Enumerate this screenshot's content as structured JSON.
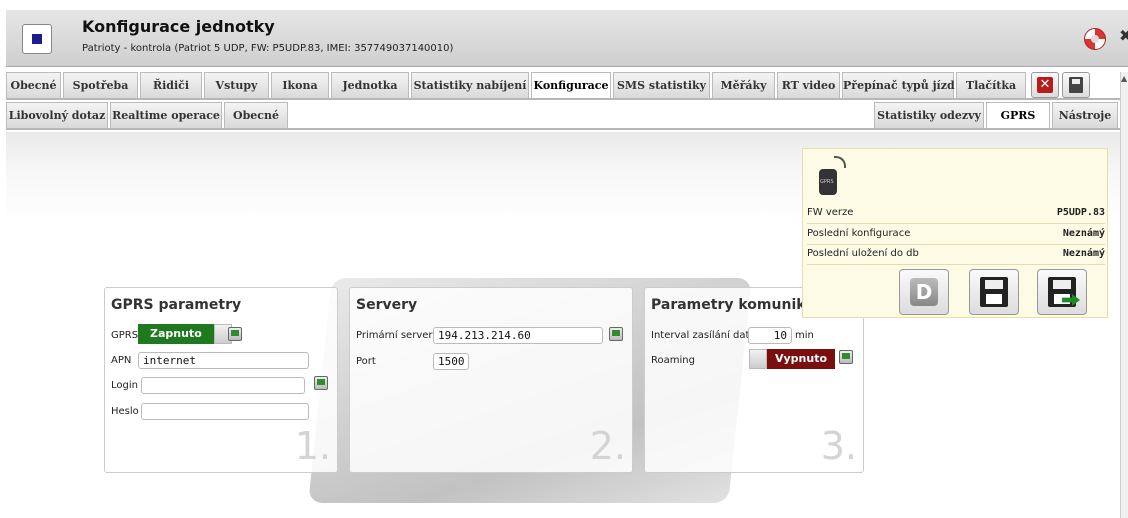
{
  "header": {
    "title": "Konfigurace jednotky",
    "subtitle": "Patrioty - kontrola (Patriot 5 UDP, FW: P5UDP.83, IMEI: 357749037140010)"
  },
  "tabs_row1": [
    "Obecné",
    "Spotřeba",
    "Řidiči",
    "Vstupy",
    "Ikona",
    "Jednotka",
    "Statistiky nabíjení",
    "Konfigurace",
    "SMS statistiky",
    "Měřáky",
    "RT video",
    "Přepínač typů jízd",
    "Tlačítka"
  ],
  "tabs_row2_left": [
    "Libovolný dotaz",
    "Realtime operace",
    "Obecné"
  ],
  "tabs_row2_right": [
    "Statistiky odezvy",
    "GPRS",
    "Nástroje"
  ],
  "active_tab_row1": "Konfigurace",
  "active_tab_row2": "GPRS",
  "gprs_panel": {
    "title": "GPRS parametry",
    "gprs_label": "GPRS",
    "gprs_state": "Zapnuto",
    "apn_label": "APN",
    "apn_value": "internet",
    "login_label": "Login",
    "login_value": "",
    "password_label": "Heslo",
    "password_value": "",
    "number": "1."
  },
  "servers_panel": {
    "title": "Servery",
    "primary_label": "Primární server",
    "primary_value": "194.213.214.60",
    "port_label": "Port",
    "port_value": "1500",
    "number": "2."
  },
  "comm_panel": {
    "title": "Parametry komunikace",
    "interval_label": "Interval zasílání dat",
    "interval_value": "10",
    "interval_unit": "min",
    "roaming_label": "Roaming",
    "roaming_state": "Vypnuto",
    "number": "3."
  },
  "info": {
    "fw_label": "FW verze",
    "fw_value": "P5UDP.83",
    "last_config_label": "Poslední konfigurace",
    "last_config_value": "Neznámý",
    "last_db_label": "Poslední uložení do db",
    "last_db_value": "Neznámý",
    "d_button": "D"
  },
  "colors": {
    "on": "#1f7a1f",
    "off": "#7a0f0f",
    "info_bg": "#fdfbe6"
  }
}
